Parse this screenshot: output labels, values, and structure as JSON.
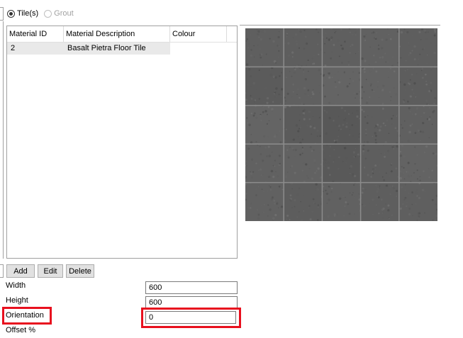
{
  "material_type": {
    "options": [
      {
        "label": "Tile(s)",
        "checked": true,
        "enabled": true
      },
      {
        "label": "Grout",
        "checked": false,
        "enabled": false
      }
    ]
  },
  "grid": {
    "columns": [
      "Material ID",
      "Material Description",
      "Colour"
    ],
    "rows": [
      {
        "material_id": "2",
        "description": "Basalt Pietra Floor Tile",
        "colour": ""
      }
    ]
  },
  "preview": {
    "icon": "tile-texture-preview",
    "tile_color": "#5e5e5e",
    "grout_color": "#8c8c8c",
    "tiles_across": 5,
    "tiles_down": 5
  },
  "buttons": {
    "add_label": "Add",
    "edit_label": "Edit",
    "delete_label": "Delete"
  },
  "properties": {
    "width_label": "Width",
    "width_value": "600",
    "height_label": "Height",
    "height_value": "600",
    "orientation_label": "Orientation",
    "orientation_value": "0",
    "offset_label": "Offset %"
  },
  "highlight_color": "#e8101e"
}
